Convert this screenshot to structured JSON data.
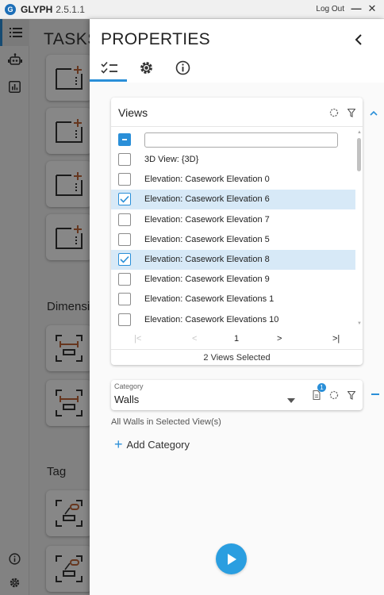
{
  "window": {
    "app_name": "GLYPH",
    "version": "2.5.1.1",
    "logout_label": "Log Out",
    "minimize_glyph": "—",
    "close_glyph": "✕"
  },
  "rail": {
    "items": [
      {
        "icon": "list-icon",
        "active": true
      },
      {
        "icon": "robot-icon",
        "active": false
      },
      {
        "icon": "chart-icon",
        "active": false
      }
    ],
    "bottom_items": [
      {
        "icon": "info-icon"
      },
      {
        "icon": "gear-icon"
      }
    ]
  },
  "background_panel": {
    "title": "TASKS",
    "sections": [
      "Dimensi",
      "Tag"
    ]
  },
  "properties": {
    "title": "PROPERTIES",
    "tabs": [
      {
        "icon": "checklist-icon",
        "active": true
      },
      {
        "icon": "gear-icon",
        "active": false
      },
      {
        "icon": "info-icon",
        "active": false
      }
    ]
  },
  "views": {
    "title": "Views",
    "search_value": "",
    "items": [
      {
        "label": "3D View: {3D}",
        "checked": false
      },
      {
        "label": "Elevation: Casework Elevation 0",
        "checked": false
      },
      {
        "label": "Elevation: Casework Elevation 6",
        "checked": true
      },
      {
        "label": "Elevation: Casework Elevation 7",
        "checked": false
      },
      {
        "label": "Elevation: Casework Elevation 5",
        "checked": false
      },
      {
        "label": "Elevation: Casework Elevation 8",
        "checked": true
      },
      {
        "label": "Elevation: Casework Elevation 9",
        "checked": false
      },
      {
        "label": "Elevation: Casework Elevations 1",
        "checked": false
      },
      {
        "label": "Elevation: Casework Elevations 10",
        "checked": false
      }
    ],
    "pager": {
      "first": "|<",
      "prev": "<",
      "page": "1",
      "next": ">",
      "last": ">|"
    },
    "status": "2 Views Selected"
  },
  "category": {
    "label": "Category",
    "value": "Walls",
    "badge_count": "1",
    "description": "All Walls in Selected View(s)",
    "add_label": "Add Category"
  },
  "colors": {
    "accent": "#2a8fd8",
    "selected_row": "#d7e9f7",
    "play": "#2a9ee0"
  }
}
